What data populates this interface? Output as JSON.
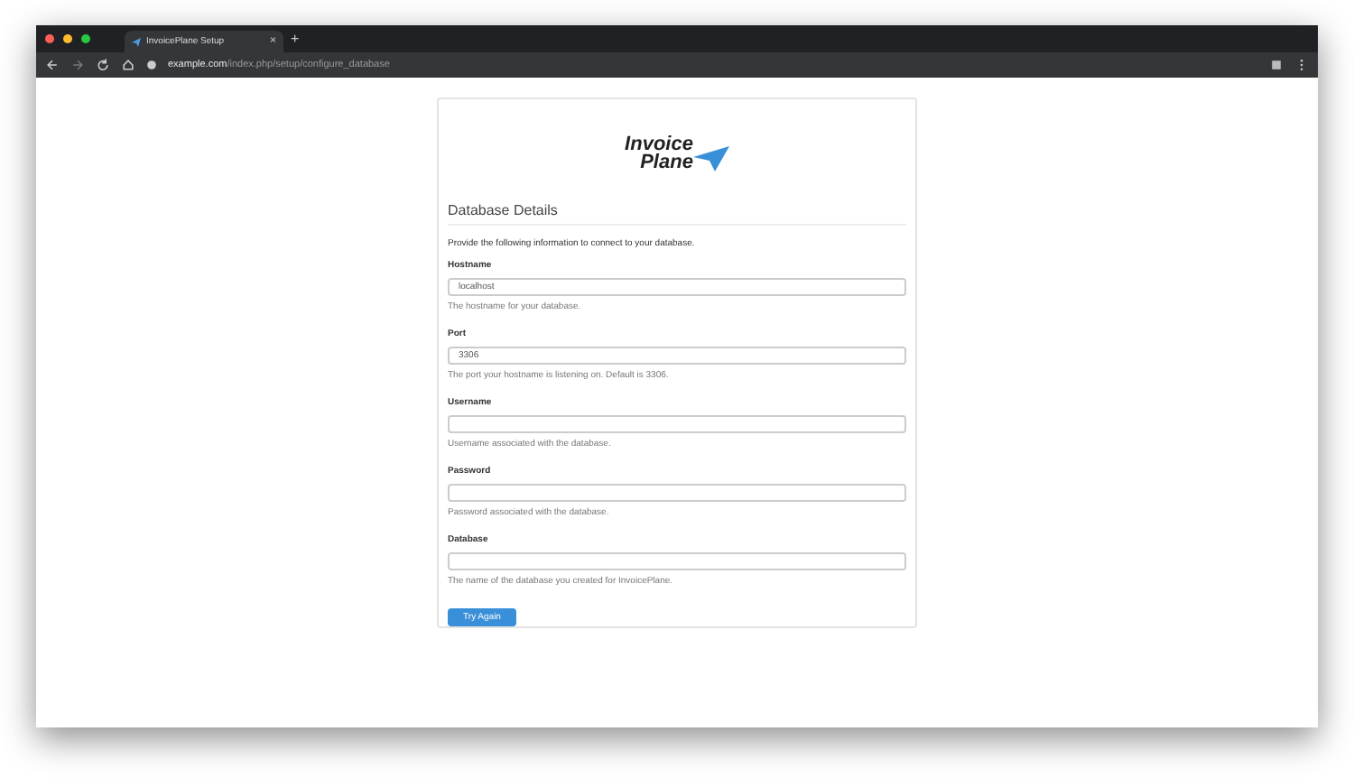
{
  "browser": {
    "tab_title": "InvoicePlane Setup",
    "tab_close": "×",
    "new_tab": "+",
    "url_host": "example.com",
    "url_path": "/index.php/setup/configure_database"
  },
  "logo": {
    "line_1": "Invoice",
    "line_2": "Plane"
  },
  "heading": "Database Details",
  "intro": "Provide the following information to connect to your database.",
  "fields": [
    {
      "label": "Hostname",
      "value": "localhost",
      "help": "The hostname for your database."
    },
    {
      "label": "Port",
      "value": "3306",
      "help": "The port your hostname is listening on. Default is 3306."
    },
    {
      "label": "Username",
      "help": "Username associated with the database."
    },
    {
      "label": "Password",
      "help": "Password associated with the database."
    },
    {
      "label": "Database",
      "help": "The name of the database you created for InvoicePlane."
    }
  ],
  "button": "Try Again"
}
